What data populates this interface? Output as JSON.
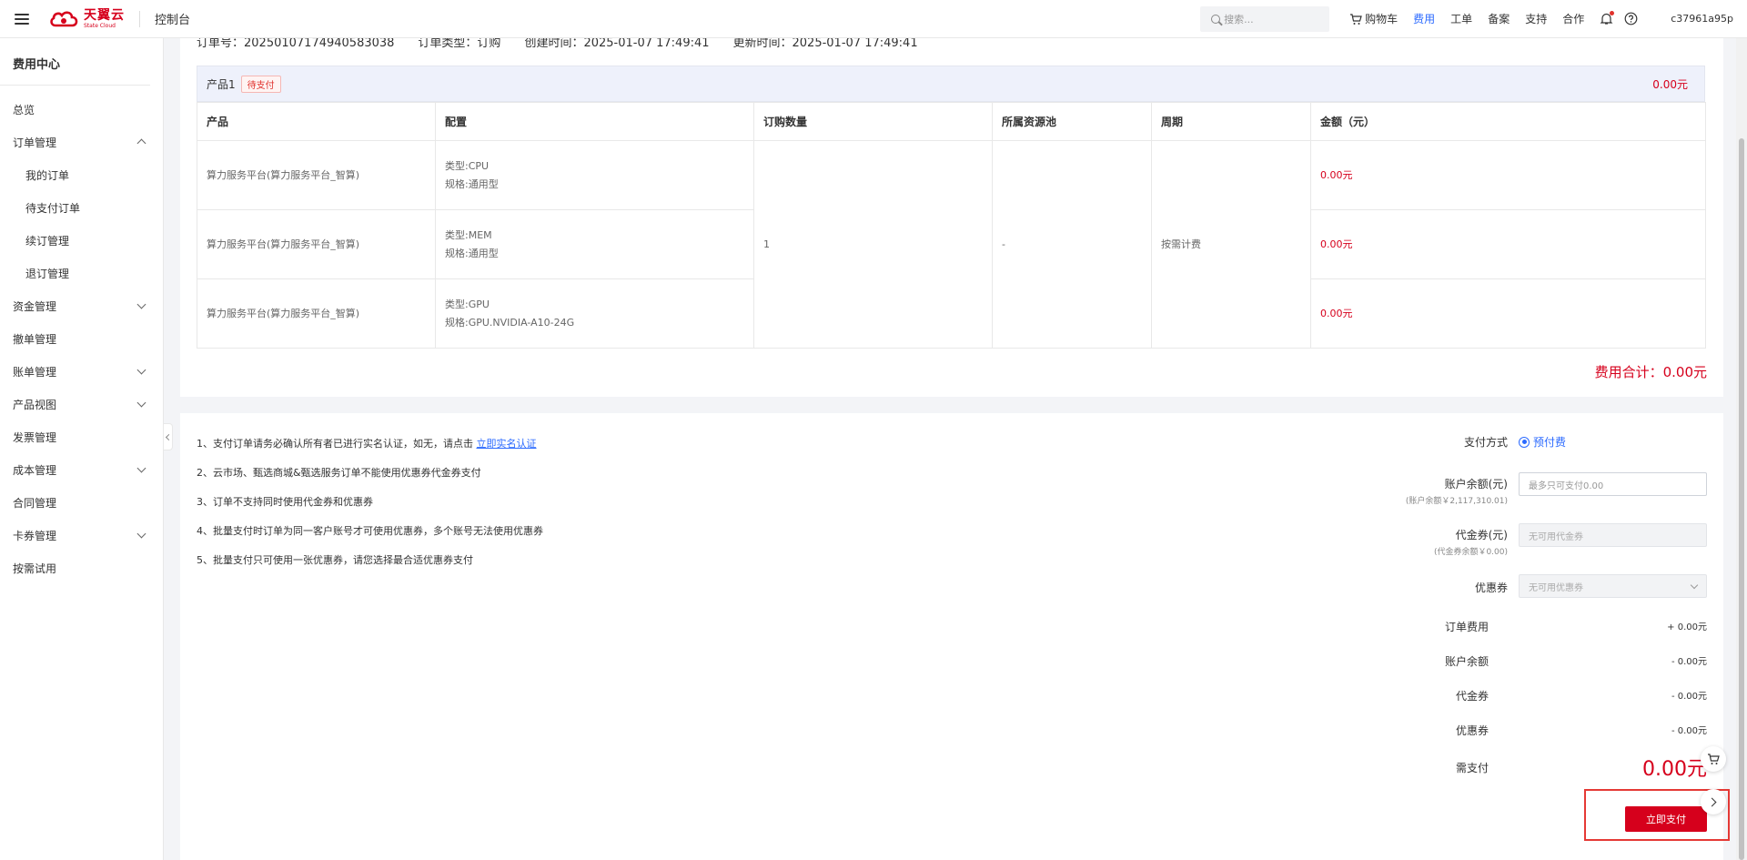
{
  "header": {
    "logo_cn": "天翼云",
    "logo_en": "State Cloud",
    "console": "控制台",
    "search_placeholder": "搜索...",
    "links": [
      "购物车",
      "费用",
      "工单",
      "备案",
      "支持",
      "合作"
    ],
    "active_link": "费用",
    "user": "c37961a95p"
  },
  "sidebar": {
    "title": "费用中心",
    "items": [
      {
        "label": "总览",
        "sub": false,
        "chevron": ""
      },
      {
        "label": "订单管理",
        "sub": false,
        "chevron": "up"
      },
      {
        "label": "我的订单",
        "sub": true,
        "chevron": ""
      },
      {
        "label": "待支付订单",
        "sub": true,
        "chevron": ""
      },
      {
        "label": "续订管理",
        "sub": true,
        "chevron": ""
      },
      {
        "label": "退订管理",
        "sub": true,
        "chevron": ""
      },
      {
        "label": "资金管理",
        "sub": false,
        "chevron": "down"
      },
      {
        "label": "撤单管理",
        "sub": false,
        "chevron": ""
      },
      {
        "label": "账单管理",
        "sub": false,
        "chevron": "down"
      },
      {
        "label": "产品视图",
        "sub": false,
        "chevron": "down"
      },
      {
        "label": "发票管理",
        "sub": false,
        "chevron": ""
      },
      {
        "label": "成本管理",
        "sub": false,
        "chevron": "down"
      },
      {
        "label": "合同管理",
        "sub": false,
        "chevron": ""
      },
      {
        "label": "卡券管理",
        "sub": false,
        "chevron": "down"
      },
      {
        "label": "按需试用",
        "sub": false,
        "chevron": ""
      }
    ]
  },
  "order": {
    "number": "订单号：20250107174940583038",
    "type": "订单类型：订购",
    "created": "创建时间：2025-01-07 17:49:41",
    "updated": "更新时间：2025-01-07 17:49:41",
    "product_name": "产品1",
    "status": "待支付",
    "product_total": "0.00元",
    "columns": [
      "产品",
      "配置",
      "订购数量",
      "所属资源池",
      "周期",
      "金额（元）"
    ],
    "rows": [
      {
        "product": "算力服务平台(算力服务平台_智算)",
        "config_type": "类型:CPU",
        "config_spec": "规格:通用型",
        "amount": "0.00元"
      },
      {
        "product": "算力服务平台(算力服务平台_智算)",
        "config_type": "类型:MEM",
        "config_spec": "规格:通用型",
        "amount": "0.00元"
      },
      {
        "product": "算力服务平台(算力服务平台_智算)",
        "config_type": "类型:GPU",
        "config_spec": "规格:GPU.NVIDIA-A10-24G",
        "amount": "0.00元"
      }
    ],
    "quantity": "1",
    "pool": "-",
    "period": "按需计费",
    "fee_total": "费用合计：0.00元"
  },
  "notes": {
    "n1_text": "1、支付订单请务必确认所有者已进行实名认证，如无，请点击 ",
    "n1_link": "立即实名认证",
    "n2": "2、云市场、甄选商城&甄选服务订单不能使用优惠券代金券支付",
    "n3": "3、订单不支持同时使用代金券和优惠券",
    "n4": "4、批量支付时订单为同一客户账号才可使用优惠券，多个账号无法使用优惠券",
    "n5": "5、批量支付只可使用一张优惠券，请您选择最合适优惠券支付"
  },
  "payment": {
    "method_label": "支付方式",
    "method_value": "预付费",
    "balance_label": "账户余额(元)",
    "balance_sub": "(账户余额￥2,117,310.01)",
    "balance_placeholder": "最多只可支付0.00",
    "voucher_label": "代金券(元)",
    "voucher_sub": "(代金券余额￥0.00)",
    "voucher_placeholder": "无可用代金券",
    "coupon_label": "优惠券",
    "coupon_placeholder": "无可用优惠券",
    "order_fee_label": "订单费用",
    "order_fee": "+ 0.00元",
    "acct_label": "账户余额",
    "acct_val": "- 0.00元",
    "voucher2_label": "代金券",
    "voucher2_val": "- 0.00元",
    "coupon2_label": "优惠券",
    "coupon2_val": "- 0.00元",
    "need_label": "需支付",
    "need_val": "0.00元",
    "pay_button": "立即支付"
  },
  "colors": {
    "brand_red": "#d6001c",
    "link_blue": "#2b6aff",
    "highlight": "#e53935"
  }
}
